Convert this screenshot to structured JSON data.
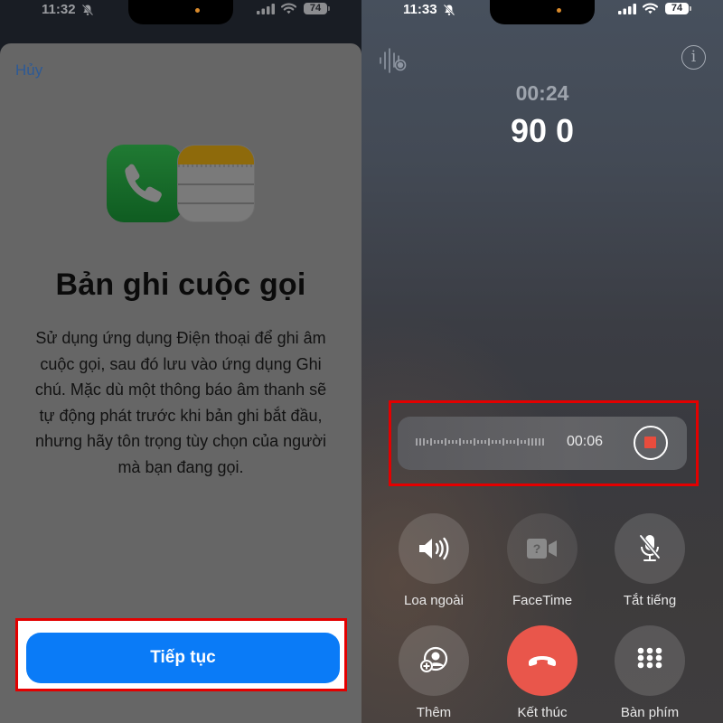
{
  "left_screen": {
    "status_bar": {
      "time": "11:32",
      "battery": "74",
      "silent_icon": "bell-slash-icon"
    },
    "sheet": {
      "cancel_label": "Hủy",
      "icons": [
        "phone-app-icon",
        "notes-app-icon"
      ],
      "title": "Bản ghi cuộc gọi",
      "description": "Sử dụng ứng dụng Điện thoại để ghi âm cuộc gọi, sau đó lưu vào ứng dụng Ghi chú. Mặc dù một thông báo âm thanh sẽ tự động phát trước khi bản ghi bắt đầu, nhưng hãy tôn trọng tùy chọn của người mà bạn đang gọi.",
      "continue_label": "Tiếp tục"
    }
  },
  "right_screen": {
    "status_bar": {
      "time": "11:33",
      "battery": "74",
      "silent_icon": "bell-slash-icon"
    },
    "call_duration": "00:24",
    "caller": "90 0",
    "recording": {
      "elapsed": "00:06",
      "stop_icon": "stop-icon"
    },
    "controls": [
      {
        "label": "Loa ngoài",
        "icon": "speaker-icon"
      },
      {
        "label": "FaceTime",
        "icon": "facetime-icon"
      },
      {
        "label": "Tắt tiếng",
        "icon": "mic-off-icon"
      },
      {
        "label": "Thêm",
        "icon": "add-call-icon"
      },
      {
        "label": "Kết thúc",
        "icon": "end-call-icon"
      },
      {
        "label": "Bàn phím",
        "icon": "keypad-icon"
      }
    ],
    "colors": {
      "end_call": "#e9564b",
      "stop": "#e84c3d",
      "highlight": "#e30000"
    }
  },
  "colors": {
    "primary_button": "#0a7bf7",
    "cancel_link": "#2e5a95"
  }
}
